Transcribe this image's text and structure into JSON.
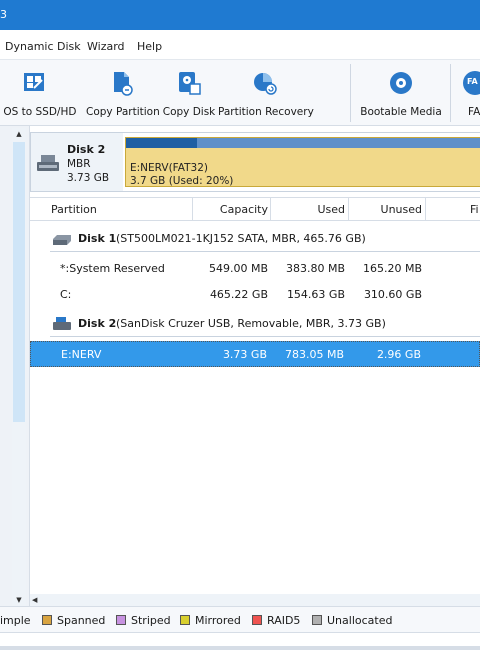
{
  "window": {
    "title_fragment": "3"
  },
  "menu": [
    "Dynamic Disk",
    "Wizard",
    "Help"
  ],
  "toolbar": {
    "items": [
      {
        "label": "e OS to SSD/HD",
        "icon": "migrate-os-icon"
      },
      {
        "label": "Copy Partition",
        "icon": "copy-partition-icon"
      },
      {
        "label": "Copy Disk",
        "icon": "copy-disk-icon"
      },
      {
        "label": "Partition Recovery",
        "icon": "partition-recovery-icon"
      },
      {
        "label": "Bootable Media",
        "icon": "bootable-media-icon"
      },
      {
        "label": "FA",
        "icon": "fat-convert-icon",
        "badge": "FA"
      }
    ]
  },
  "disk_map": {
    "disk_name": "Disk 2",
    "disk_type": "MBR",
    "disk_size": "3.73 GB",
    "partition_name": "E:NERV(FAT32)",
    "partition_detail": "3.7 GB (Used: 20%)",
    "used_fraction": 0.2
  },
  "table": {
    "headers": {
      "partition": "Partition",
      "capacity": "Capacity",
      "used": "Used",
      "unused": "Unused",
      "fs": "Fi"
    },
    "disk1": {
      "name": "Disk 1",
      "desc": "(ST500LM021-1KJ152 SATA, MBR, 465.76 GB)"
    },
    "disk1_partitions": [
      {
        "name": "*:System Reserved",
        "capacity": "549.00 MB",
        "used": "383.80 MB",
        "unused": "165.20 MB"
      },
      {
        "name": "C:",
        "capacity": "465.22 GB",
        "used": "154.63 GB",
        "unused": "310.60 GB"
      }
    ],
    "disk2": {
      "name": "Disk 2",
      "desc": "(SanDisk Cruzer USB, Removable, MBR, 3.73 GB)"
    },
    "disk2_partitions": [
      {
        "name": "E:NERV",
        "capacity": "3.73 GB",
        "used": "783.05 MB",
        "unused": "2.96 GB"
      }
    ]
  },
  "legend": [
    {
      "label": "imple",
      "color": ""
    },
    {
      "label": "Spanned",
      "color": "#d9a441"
    },
    {
      "label": "Striped",
      "color": "#c792e0"
    },
    {
      "label": "Mirrored",
      "color": "#d8cf2e"
    },
    {
      "label": "RAID5",
      "color": "#ef5350"
    },
    {
      "label": "Unallocated",
      "color": "#b0b0b0"
    }
  ],
  "colors": {
    "titlebar": "#1f7ad1",
    "selection": "#3399ea",
    "partition_fat32": "#f1d98a"
  }
}
